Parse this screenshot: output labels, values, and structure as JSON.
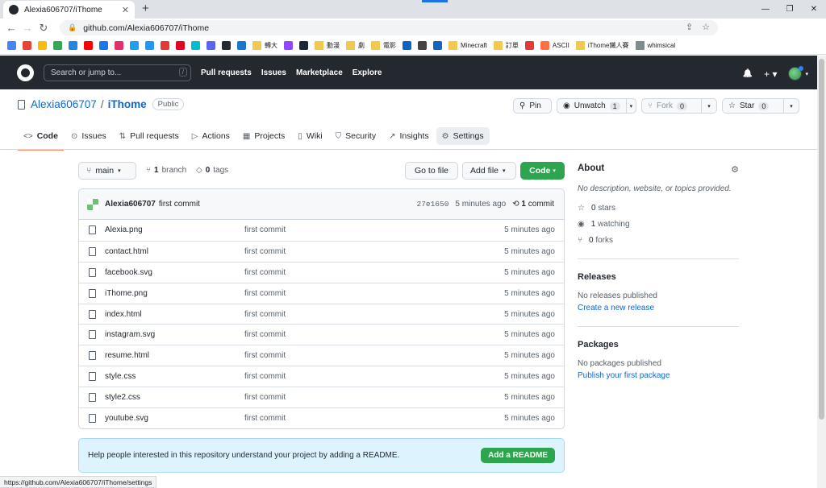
{
  "browser": {
    "tab_title": "Alexia606707/iThome",
    "tab_close": "✕",
    "new_tab": "+",
    "window_controls": [
      "—",
      "❐",
      "✕"
    ],
    "url": "github.com/Alexia606707/iThome",
    "status_url": "https://github.com/Alexia606707/iThome/settings"
  },
  "bookmarks": [
    {
      "label": "",
      "color": "#4285f4"
    },
    {
      "label": "",
      "color": "#ea4335"
    },
    {
      "label": "",
      "color": "#fbbc05"
    },
    {
      "label": "",
      "color": "#34a853"
    },
    {
      "label": "",
      "color": "#1e88e5"
    },
    {
      "label": "",
      "color": "#ff0000"
    },
    {
      "label": "",
      "color": "#1877f2"
    },
    {
      "label": "",
      "color": "#e1306c"
    },
    {
      "label": "",
      "color": "#1da1f2"
    },
    {
      "label": "",
      "color": "#2196f3"
    },
    {
      "label": "",
      "color": "#e53935"
    },
    {
      "label": "",
      "color": "#e60023"
    },
    {
      "label": "",
      "color": "#00bcd4"
    },
    {
      "label": "",
      "color": "#5865f2"
    },
    {
      "label": "",
      "color": "#24292f"
    },
    {
      "label": "",
      "color": "#1976d2"
    },
    {
      "label": "轉大",
      "color": "#f2c94c",
      "folder": true
    },
    {
      "label": "",
      "color": "#9146ff"
    },
    {
      "label": "",
      "color": "#1b2838"
    },
    {
      "label": "動漫",
      "color": "#f2c94c",
      "folder": true
    },
    {
      "label": "劇",
      "color": "#f2c94c",
      "folder": true
    },
    {
      "label": "電影",
      "color": "#f2c94c",
      "folder": true
    },
    {
      "label": "",
      "color": "#0a66c2"
    },
    {
      "label": "",
      "color": "#444444"
    },
    {
      "label": "",
      "color": "#1565c0"
    },
    {
      "label": "Minecraft",
      "color": "#f2c94c",
      "folder": true
    },
    {
      "label": "訂單",
      "color": "#f2c94c",
      "folder": true
    },
    {
      "label": "",
      "color": "#e53935"
    },
    {
      "label": "ASCII",
      "color": "#ff7043"
    },
    {
      "label": "iThome鐵人賽",
      "color": "#f2c94c",
      "folder": true
    },
    {
      "label": "whimsical",
      "color": "#7f8c8d",
      "folder": true
    }
  ],
  "header": {
    "search_placeholder": "Search or jump to...",
    "search_key": "/",
    "nav": [
      "Pull requests",
      "Issues",
      "Marketplace",
      "Explore"
    ],
    "bell": "🔔",
    "plus": "+ ▾"
  },
  "repo": {
    "owner": "Alexia606707",
    "sep": "/",
    "name": "iThome",
    "visibility": "Public",
    "pin": "Pin",
    "unwatch": "Unwatch",
    "watch_count": "1",
    "fork": "Fork",
    "fork_count": "0",
    "star": "Star",
    "star_count": "0",
    "dd": "▾"
  },
  "tabs": [
    {
      "icon": "<>",
      "label": "Code"
    },
    {
      "icon": "⊙",
      "label": "Issues"
    },
    {
      "icon": "⇅",
      "label": "Pull requests"
    },
    {
      "icon": "▷",
      "label": "Actions"
    },
    {
      "icon": "▦",
      "label": "Projects"
    },
    {
      "icon": "▯",
      "label": "Wiki"
    },
    {
      "icon": "⛉",
      "label": "Security"
    },
    {
      "icon": "↗",
      "label": "Insights"
    },
    {
      "icon": "⚙",
      "label": "Settings"
    }
  ],
  "filebar": {
    "branch": "main",
    "branches_count": "1",
    "branches_label": "branch",
    "tags_count": "0",
    "tags_label": "tags",
    "go_to_file": "Go to file",
    "add_file": "Add file",
    "code": "Code"
  },
  "commit": {
    "author": "Alexia606707",
    "message": "first commit",
    "hash": "27e1650",
    "time": "5 minutes ago",
    "count": "1",
    "count_label": "commit"
  },
  "files": [
    {
      "name": "Alexia.png",
      "msg": "first commit",
      "time": "5 minutes ago"
    },
    {
      "name": "contact.html",
      "msg": "first commit",
      "time": "5 minutes ago"
    },
    {
      "name": "facebook.svg",
      "msg": "first commit",
      "time": "5 minutes ago"
    },
    {
      "name": "iThome.png",
      "msg": "first commit",
      "time": "5 minutes ago"
    },
    {
      "name": "index.html",
      "msg": "first commit",
      "time": "5 minutes ago"
    },
    {
      "name": "instagram.svg",
      "msg": "first commit",
      "time": "5 minutes ago"
    },
    {
      "name": "resume.html",
      "msg": "first commit",
      "time": "5 minutes ago"
    },
    {
      "name": "style.css",
      "msg": "first commit",
      "time": "5 minutes ago"
    },
    {
      "name": "style2.css",
      "msg": "first commit",
      "time": "5 minutes ago"
    },
    {
      "name": "youtube.svg",
      "msg": "first commit",
      "time": "5 minutes ago"
    }
  ],
  "readme": {
    "text": "Help people interested in this repository understand your project by adding a README.",
    "button": "Add a README"
  },
  "about": {
    "title": "About",
    "description": "No description, website, or topics provided.",
    "stars": "0",
    "stars_label": "stars",
    "watching": "1",
    "watching_label": "watching",
    "forks": "0",
    "forks_label": "forks"
  },
  "releases": {
    "title": "Releases",
    "text": "No releases published",
    "link": "Create a new release"
  },
  "packages": {
    "title": "Packages",
    "text": "No packages published",
    "link": "Publish your first package"
  },
  "colors": {
    "header_bg": "#24292f",
    "accent_green": "#2da44e",
    "link_blue": "#0969da",
    "tab_underline": "#fd8c73"
  }
}
